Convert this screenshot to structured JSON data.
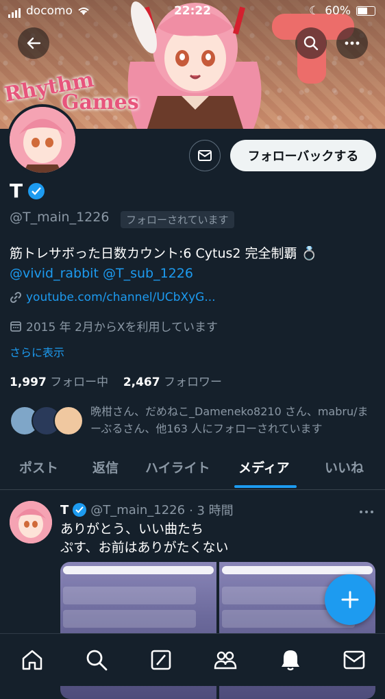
{
  "status_bar": {
    "carrier": "docomo",
    "time": "22:22",
    "battery": "60%"
  },
  "banner": {
    "text_line1": "Rhythm",
    "text_line2": "Games"
  },
  "profile": {
    "follow_back_label": "フォローバックする",
    "name": "T",
    "handle": "@T_main_1226",
    "follows_you": "フォローされています",
    "bio_line1": "筋トレサボった日数カウント:6 Cytus2 完全制覇 💍",
    "bio_mention1": "@vivid_rabbit",
    "bio_mention2": "@T_sub_1226",
    "website": "youtube.com/channel/UCbXyG...",
    "joined": "2015 年 2月からXを利用しています",
    "show_more": "さらに表示",
    "following_count": "1,997",
    "following_label": "フォロー中",
    "followers_count": "2,467",
    "followers_label": "フォロワー",
    "mutual_followers_text": "晩柑さん、だめねこ_Dameneko8210 さん、mabru/まーぶるさん、他163 人にフォローされています"
  },
  "tabs": [
    {
      "label": "ポスト"
    },
    {
      "label": "返信"
    },
    {
      "label": "ハイライト"
    },
    {
      "label": "メディア"
    },
    {
      "label": "いいね"
    }
  ],
  "active_tab": "メディア",
  "post": {
    "name": "T",
    "handle": "@T_main_1226",
    "time": "· 3 時間",
    "line1": "ありがとう、いい曲たち",
    "line2": "ぷす、お前はありがたくない"
  },
  "colors": {
    "accent": "#1d9bf0",
    "background": "#15202b"
  },
  "icons": [
    "back-arrow-icon",
    "search-icon",
    "more-icon",
    "mail-icon",
    "verified-icon",
    "link-icon",
    "calendar-icon",
    "compose-plus-icon",
    "home-icon",
    "explore-icon",
    "grok-icon",
    "communities-icon",
    "notifications-icon",
    "messages-icon"
  ]
}
